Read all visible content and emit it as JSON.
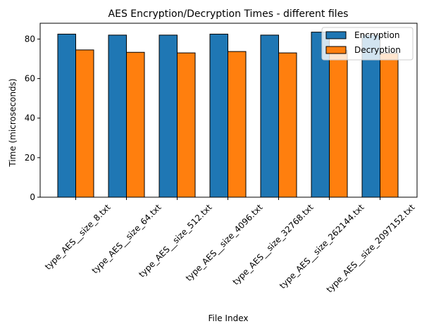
{
  "chart_data": {
    "type": "bar",
    "title": "AES Encryption/Decryption Times - different files",
    "xlabel": "File Index",
    "ylabel": "Time (microseconds)",
    "categories": [
      "type_AES__size_8.txt",
      "type_AES__size_64.txt",
      "type_AES__size_512.txt",
      "type_AES__size_4096.txt",
      "type_AES__size_32768.txt",
      "type_AES__size_262144.txt",
      "type_AES__size_2097152.txt"
    ],
    "series": [
      {
        "name": "Encryption",
        "color": "#1f77b4",
        "values": [
          82.5,
          82.0,
          82.0,
          82.5,
          82.0,
          83.5,
          82.0
        ]
      },
      {
        "name": "Decryption",
        "color": "#ff7f0e",
        "values": [
          74.5,
          73.3,
          73.0,
          73.7,
          73.0,
          74.2,
          72.8
        ]
      }
    ],
    "ylim": [
      0,
      88
    ],
    "yticks": [
      0,
      20,
      40,
      60,
      80
    ],
    "grid": false,
    "legend_position": "top-right"
  }
}
